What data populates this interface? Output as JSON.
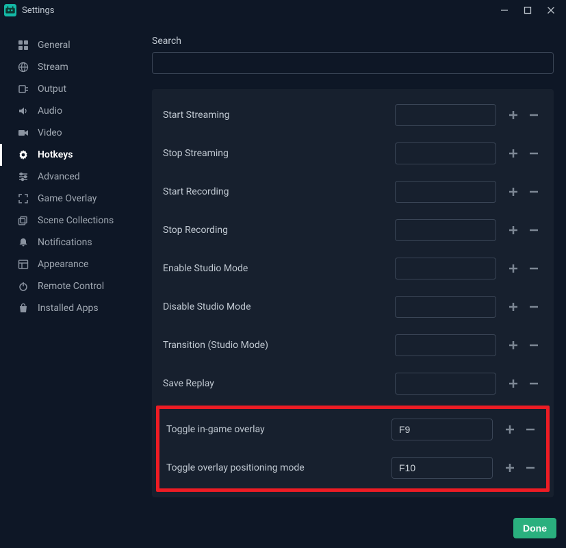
{
  "window": {
    "title": "Settings"
  },
  "sidebar": {
    "items": [
      {
        "label": "General"
      },
      {
        "label": "Stream"
      },
      {
        "label": "Output"
      },
      {
        "label": "Audio"
      },
      {
        "label": "Video"
      },
      {
        "label": "Hotkeys"
      },
      {
        "label": "Advanced"
      },
      {
        "label": "Game Overlay"
      },
      {
        "label": "Scene Collections"
      },
      {
        "label": "Notifications"
      },
      {
        "label": "Appearance"
      },
      {
        "label": "Remote Control"
      },
      {
        "label": "Installed Apps"
      }
    ],
    "active_index": 5
  },
  "main": {
    "search_label": "Search",
    "search_value": "",
    "hotkeys": [
      {
        "label": "Start Streaming",
        "value": ""
      },
      {
        "label": "Stop Streaming",
        "value": ""
      },
      {
        "label": "Start Recording",
        "value": ""
      },
      {
        "label": "Stop Recording",
        "value": ""
      },
      {
        "label": "Enable Studio Mode",
        "value": ""
      },
      {
        "label": "Disable Studio Mode",
        "value": ""
      },
      {
        "label": "Transition (Studio Mode)",
        "value": ""
      },
      {
        "label": "Save Replay",
        "value": ""
      },
      {
        "label": "Toggle in-game overlay",
        "value": "F9",
        "hl": true
      },
      {
        "label": "Toggle overlay positioning mode",
        "value": "F10",
        "hl": true
      }
    ]
  },
  "footer": {
    "done_label": "Done"
  }
}
